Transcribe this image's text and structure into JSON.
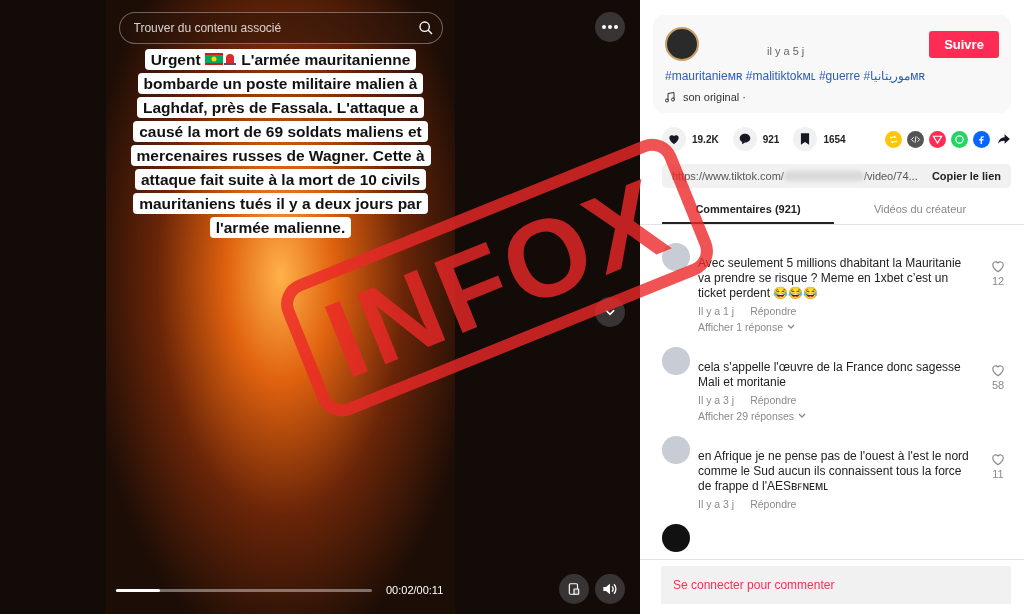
{
  "video": {
    "search": {
      "placeholder": "Trouver du contenu associé"
    },
    "caption": {
      "lead": "Urgent",
      "text": "L'armée mauritanienne bombarde un poste militaire malien à Laghdaf, près de Fassala. L'attaque a causé la mort de 69 soldats maliens et mercenaires russes de Wagner. Cette à attaque fait suite à la mort de 10 civils mauritaniens tués il y a deux jours par l'armée malienne."
    },
    "progress": {
      "level": 0.17
    },
    "time": "00:02/00:11"
  },
  "stamp": "INFOX",
  "creator": {
    "posted": "il y a 5 j",
    "follow": "Suivre",
    "hashtags": "#mauritanieᴍʀ #malitiktokᴍʟ #guerre #موريتانياᴍʀ",
    "sound": "son original ·"
  },
  "stats": [
    {
      "kind": "like",
      "count": "19.2K"
    },
    {
      "kind": "comment",
      "count": "921"
    },
    {
      "kind": "save",
      "count": "1654"
    }
  ],
  "share": [
    {
      "kind": "repost",
      "color": "#fdc60a"
    },
    {
      "kind": "embed",
      "color": "#545454"
    },
    {
      "kind": "send",
      "color": "#fe2c55"
    },
    {
      "kind": "whatsapp",
      "color": "#25d366"
    },
    {
      "kind": "facebook",
      "color": "#0866ff"
    },
    {
      "kind": "more"
    }
  ],
  "link": {
    "url": "https://www.tiktok.com/",
    "url_end": "/video/74...",
    "copy": "Copier le lien"
  },
  "tabs": [
    {
      "label": "Commentaires (921)",
      "selected": true
    },
    {
      "label": "Vidéos du créateur",
      "selected": false
    }
  ],
  "comments": [
    {
      "text": "Avec seulement 5 millions dhabitant la Mauritanie va prendre se risque ? Meme en 1xbet c’est un ticket perdent 😂😂😂",
      "time": "Il y a 1 j",
      "reply": "Répondre",
      "replies": "Afficher 1 réponse",
      "likes": "12"
    },
    {
      "text": "cela s'appelle l'œuvre de la France donc sagesse Mali et moritanie",
      "time": "Il y a 3 j",
      "reply": "Répondre",
      "replies": "Afficher 29 réponses",
      "likes": "58"
    },
    {
      "text": "en Afrique je ne pense pas de l'ouest à l'est le nord comme le Sud aucun ils connaissent tous la force de frappe d l'AESʙꜰɴᴇᴍʟ",
      "time": "Il y a 3 j",
      "reply": "Répondre",
      "likes": "11"
    }
  ],
  "login": "Se connecter pour commenter"
}
